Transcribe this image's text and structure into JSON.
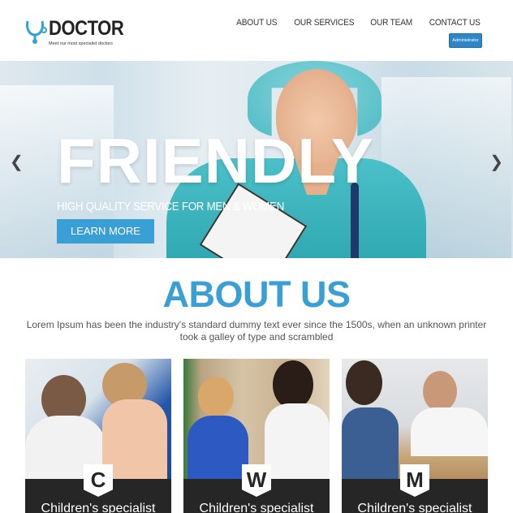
{
  "header": {
    "logo_text": "DOCTOR",
    "logo_tagline": "Meet our most specialist doctors",
    "nav": [
      "ABOUT US",
      "OUR SERVICES",
      "OUR TEAM",
      "CONTACT US"
    ],
    "admin_button": "Administrator"
  },
  "hero": {
    "title": "FRIENDLY",
    "subtitle": "HIGH QUALITY SERVICE FOR MEN & WOMEN",
    "cta": "LEARN MORE",
    "prev_icon": "chevron-left-icon",
    "next_icon": "chevron-right-icon"
  },
  "about": {
    "title": "ABOUT US",
    "text": "Lorem Ipsum has been the industry's standard dummy text ever since the 1500s, when an unknown printer took a galley of type and scrambled"
  },
  "cards": [
    {
      "badge": "C",
      "label": "Children's specialist"
    },
    {
      "badge": "W",
      "label": "Children's specialist"
    },
    {
      "badge": "M",
      "label": "Children's specialist"
    }
  ],
  "colors": {
    "accent": "#3a9fd5",
    "button": "#2e86c8",
    "card_bar": "#262626"
  }
}
